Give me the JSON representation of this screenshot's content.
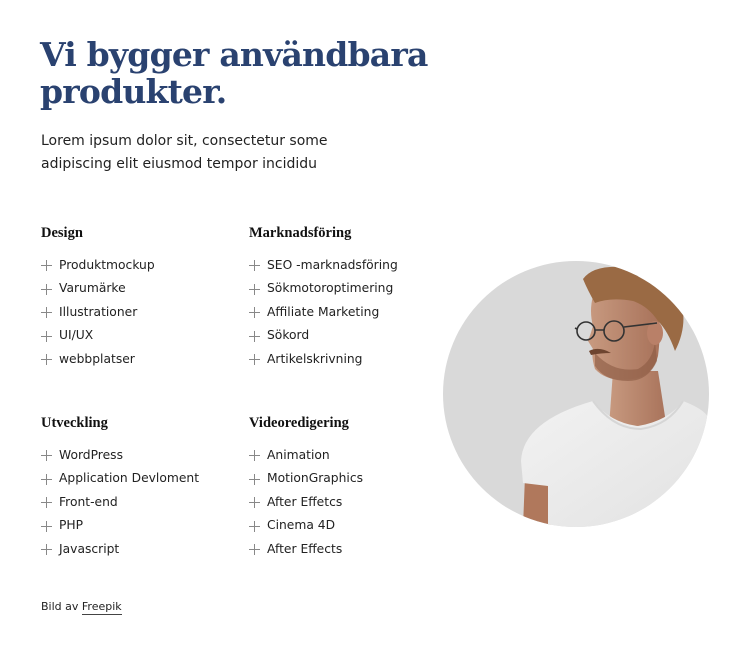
{
  "hero": {
    "title": "Vi bygger användbara produkter.",
    "subtitle": "Lorem ipsum dolor sit, consectetur some adipiscing elit eiusmod tempor incididu"
  },
  "groups": [
    {
      "heading": "Design",
      "items": [
        "Produktmockup",
        "Varumärke",
        "Illustrationer",
        "UI/UX",
        "webbplatser"
      ]
    },
    {
      "heading": "Marknadsföring",
      "items": [
        "SEO -marknadsföring",
        "Sökmotoroptimering",
        "Affiliate Marketing",
        "Sökord",
        "Artikelskrivning"
      ]
    },
    {
      "heading": "Utveckling",
      "items": [
        "WordPress",
        "Application Devloment",
        "Front-end",
        "PHP",
        "Javascript"
      ]
    },
    {
      "heading": "Videoredigering",
      "items": [
        "Animation",
        "MotionGraphics",
        "After Effetcs",
        "Cinema 4D",
        "After Effects"
      ]
    }
  ],
  "credit": {
    "prefix": "Bild av",
    "link": "Freepik"
  },
  "image": {
    "alt": "Man with glasses and white t-shirt looking left"
  },
  "colors": {
    "title": "#2a4270",
    "photo_bg": "#d9d9d9",
    "icon": "#888888"
  }
}
